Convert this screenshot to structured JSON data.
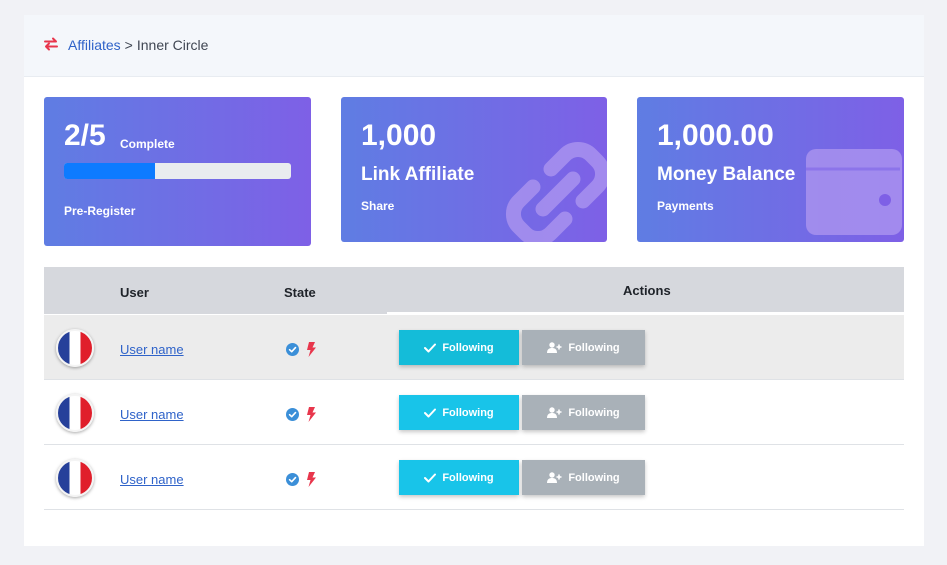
{
  "breadcrumb": {
    "icon": "swap-arrows-icon",
    "link": "Affiliates",
    "separator": ">",
    "current": "Inner Circle"
  },
  "cards": {
    "progress": {
      "value": "2/5",
      "suffix": "Complete",
      "fraction": 0.4,
      "label": "Pre-Register"
    },
    "affiliate": {
      "value": "1,000",
      "title": "Link Affiliate",
      "label": "Share",
      "icon": "link-icon"
    },
    "balance": {
      "value": "1,000.00",
      "title": "Money Balance",
      "label": "Payments",
      "icon": "wallet-icon"
    }
  },
  "table": {
    "headers": {
      "user": "User",
      "state": "State",
      "actions": "Actions"
    },
    "rows": [
      {
        "name": "User name",
        "follow_label": "Following",
        "user_label": "Following"
      },
      {
        "name": "User name",
        "follow_label": "Following",
        "user_label": "Following"
      },
      {
        "name": "User name",
        "follow_label": "Following",
        "user_label": "Following"
      }
    ]
  },
  "colors": {
    "accent": "#2f63c9",
    "card_gradient_start": "#5f7de3",
    "card_gradient_end": "#7e60e6",
    "follow_button": "#18c4e9",
    "user_button": "#a9b1b8",
    "progress_fill": "#0d7bff",
    "bolt": "#e8364c",
    "check": "#3b8fd8"
  }
}
